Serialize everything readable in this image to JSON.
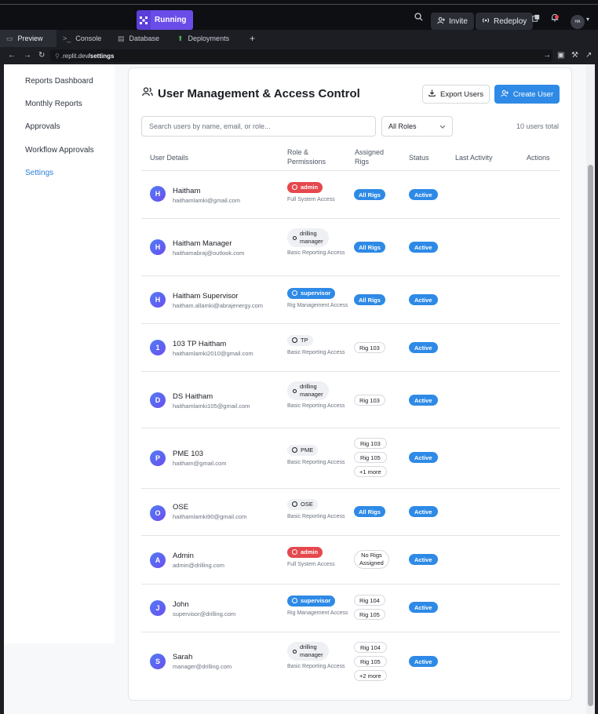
{
  "topbar": {
    "run_label": "Running",
    "invite_label": "Invite",
    "redeploy_label": "Redeploy",
    "avatar_initials": "HA"
  },
  "tabs": [
    {
      "label": "Preview"
    },
    {
      "label": "Console"
    },
    {
      "label": "Database"
    },
    {
      "label": "Deployments"
    }
  ],
  "url": {
    "prefix": ".replit.dev",
    "path": "/settings"
  },
  "sidebar": {
    "items": [
      {
        "label": "Reports Dashboard"
      },
      {
        "label": "Monthly Reports"
      },
      {
        "label": "Approvals"
      },
      {
        "label": "Workflow Approvals"
      },
      {
        "label": "Settings"
      }
    ]
  },
  "page": {
    "title": "User Management & Access Control",
    "export_label": "Export Users",
    "create_label": "Create User",
    "search_placeholder": "Search users by name, email, or role...",
    "role_filter": "All Roles",
    "count_text": "10 users total"
  },
  "table": {
    "headers": {
      "user": "User Details",
      "role_1": "Role &",
      "role_2": "Permissions",
      "rigs_1": "Assigned",
      "rigs_2": "Rigs",
      "status": "Status",
      "activity": "Last Activity",
      "actions": "Actions"
    },
    "rows": [
      {
        "initial": "H",
        "name": "Haitham",
        "email": "haithamlamki@gmail.com",
        "role": "admin",
        "role_desc": "Full System Access",
        "rig_1": "All Rigs",
        "status": "Active"
      },
      {
        "initial": "H",
        "name": "Haitham Manager",
        "email": "haithamabraj@outlook.com",
        "role_1": "drilling",
        "role_2": "manager",
        "role_desc": "Basic Reporting Access",
        "rig_1": "All Rigs",
        "status": "Active"
      },
      {
        "initial": "H",
        "name": "Haitham Supervisor",
        "email": "haitham.allamki@abrajenergy.com",
        "role": "supervisor",
        "role_desc": "Rig Management Access",
        "rig_1": "All Rigs",
        "status": "Active"
      },
      {
        "initial": "1",
        "name": "103 TP Haitham",
        "email": "haithamlamki2010@gmail.com",
        "role": "TP",
        "role_desc": "Basic Reporting Access",
        "rig_1": "Rig 103",
        "status": "Active"
      },
      {
        "initial": "D",
        "name": "DS Haitham",
        "email": "haithamlamki105@gmail.com",
        "role_1": "drilling",
        "role_2": "manager",
        "role_desc": "Basic Reporting Access",
        "rig_1": "Rig 103",
        "status": "Active"
      },
      {
        "initial": "P",
        "name": "PME 103",
        "email": "haitham@gmail.com",
        "role": "PME",
        "role_desc": "Basic Reporting Access",
        "rig_1": "Rig 103",
        "rig_2": "Rig 105",
        "rig_3": "+1 more",
        "status": "Active"
      },
      {
        "initial": "O",
        "name": "OSE",
        "email": "haithamlamki90@gmail.com",
        "role": "OSE",
        "role_desc": "Basic Reporting Access",
        "rig_1": "All Rigs",
        "status": "Active"
      },
      {
        "initial": "A",
        "name": "Admin",
        "email": "admin@drilling.com",
        "role": "admin",
        "role_desc": "Full System Access",
        "rig_1a": "No Rigs",
        "rig_1b": "Assigned",
        "status": "Active"
      },
      {
        "initial": "J",
        "name": "John",
        "email": "supervisor@drilling.com",
        "role": "supervisor",
        "role_desc": "Rig Management Access",
        "rig_1": "Rig 104",
        "rig_2": "Rig 105",
        "status": "Active"
      },
      {
        "initial": "S",
        "name": "Sarah",
        "email": "manager@drilling.com",
        "role_1": "drilling",
        "role_2": "manager",
        "role_desc": "Basic Reporting Access",
        "rig_1": "Rig 104",
        "rig_2": "Rig 105",
        "rig_3": "+2 more",
        "status": "Active"
      }
    ]
  },
  "colors": {
    "primary": "#2e8ae6",
    "admin": "#e5484d",
    "run": "#6a4ce8"
  }
}
